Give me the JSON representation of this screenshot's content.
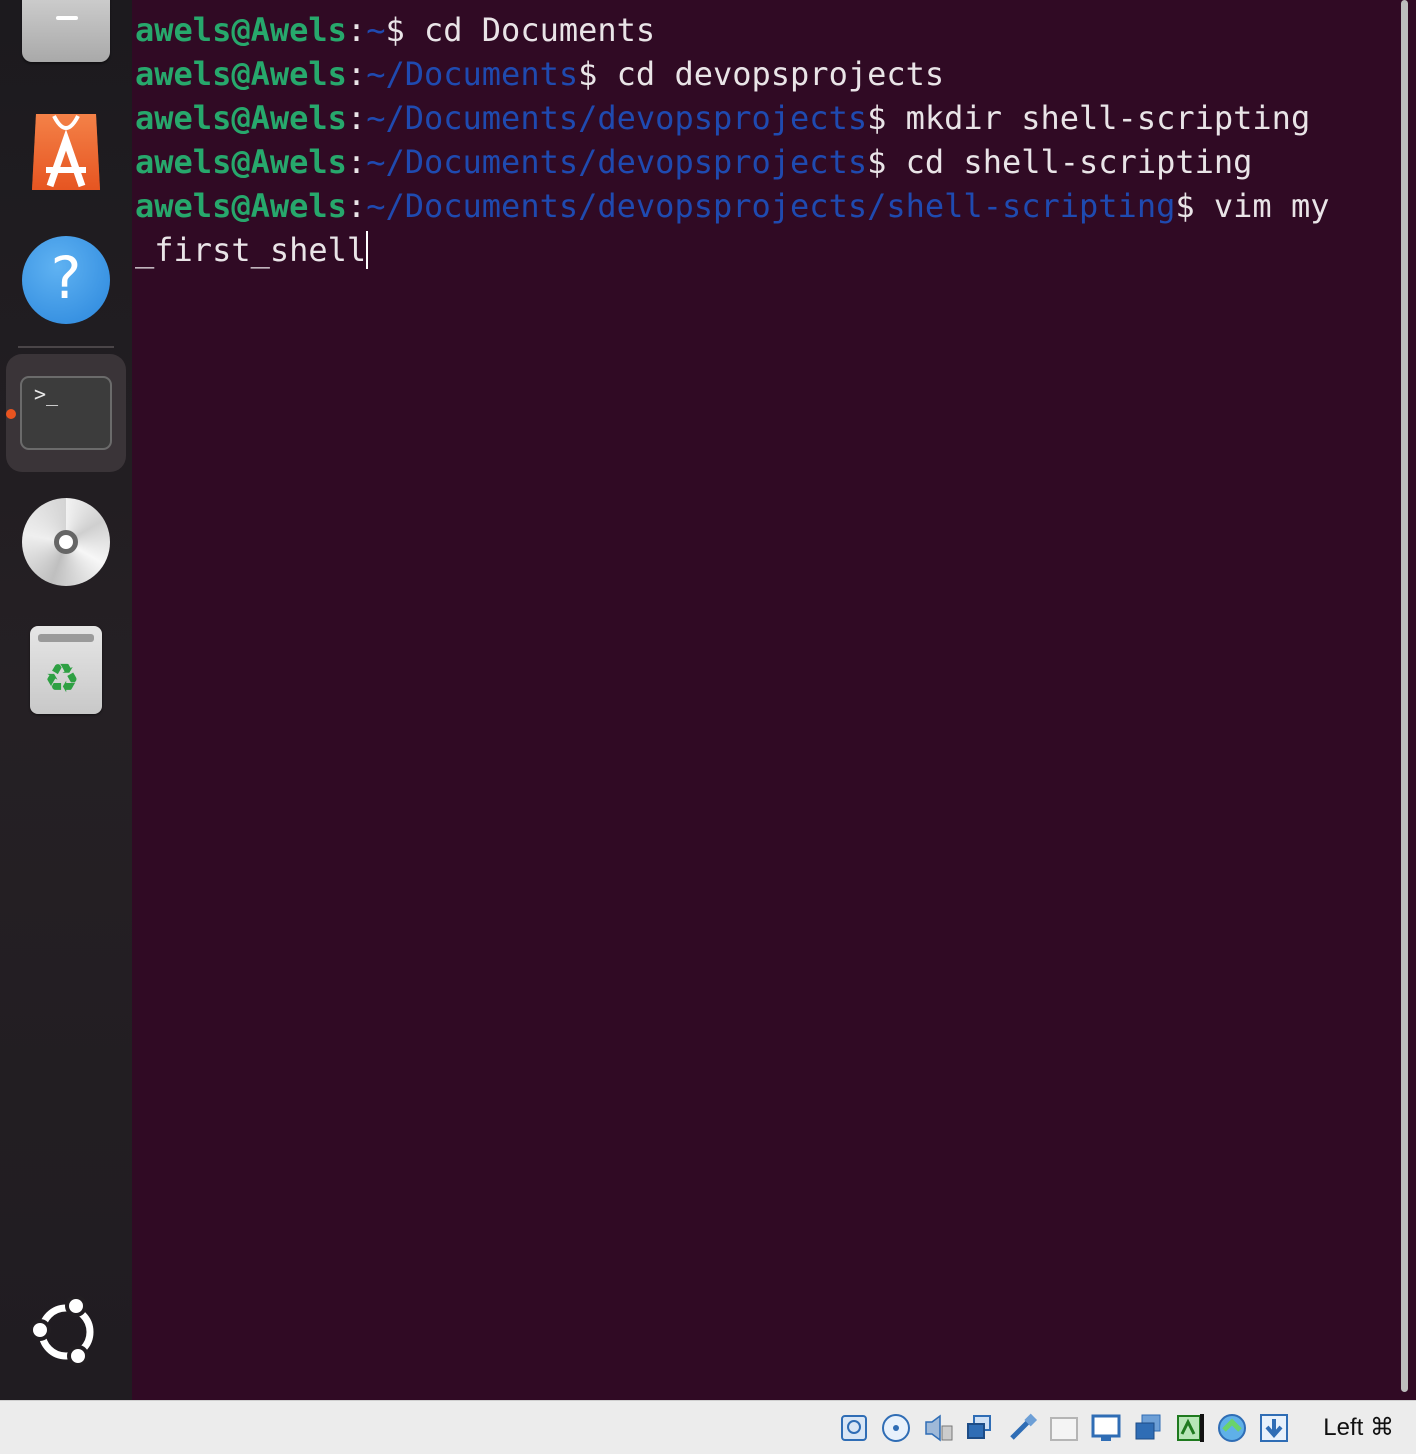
{
  "dock": {
    "items": [
      {
        "name": "files",
        "icon": "files-icon"
      },
      {
        "name": "app-center",
        "icon": "app-center-icon"
      },
      {
        "name": "help",
        "icon": "help-icon",
        "glyph": "?"
      },
      {
        "name": "terminal",
        "icon": "terminal-icon",
        "glyph": ">_",
        "running": true
      },
      {
        "name": "optical-disc",
        "icon": "disc-icon"
      },
      {
        "name": "trash",
        "icon": "trash-icon",
        "glyph": "♻"
      },
      {
        "name": "show-apps",
        "icon": "ubuntu-logo-icon"
      }
    ],
    "running_indicator_color": "#e95420"
  },
  "terminal": {
    "background": "#300a24",
    "user_host": "awels@Awels",
    "lines": [
      {
        "path": "~",
        "command": " cd Documents"
      },
      {
        "path": "~/Documents",
        "command": " cd devopsprojects"
      },
      {
        "path": "~/Documents/devopsprojects",
        "command": " mkdir shell-scripting"
      },
      {
        "path": "~/Documents/devopsprojects",
        "command": " cd shell-scripting"
      },
      {
        "path": "~/Documents/devopsprojects/shell-scripting",
        "command": " vim my"
      }
    ],
    "wrapped_input": "_first_shell"
  },
  "statusbar": {
    "icons": [
      "hard-disk-icon",
      "optical-drive-icon",
      "audio-icon",
      "network-icon",
      "usb-icon",
      "shared-folder-icon",
      "display-icon",
      "recording-icon",
      "cpu-icon",
      "mouse-integration-icon",
      "keyboard-capture-icon"
    ],
    "host_key": "Left ⌘"
  }
}
